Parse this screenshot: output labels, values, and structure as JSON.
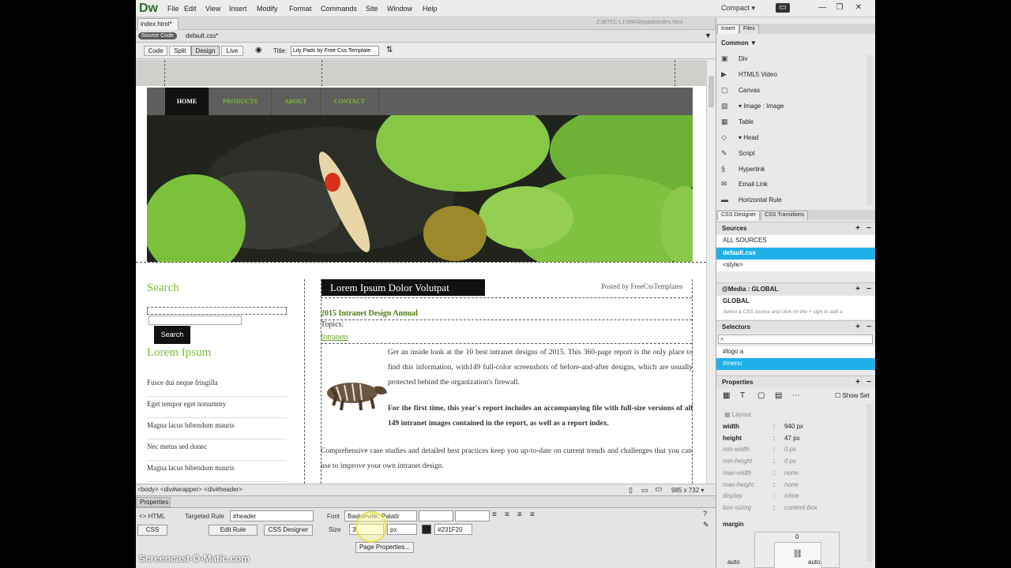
{
  "app": {
    "logo": "Dw",
    "menu": [
      "File",
      "Edit",
      "View",
      "Insert",
      "Modify",
      "Format",
      "Commands",
      "Site",
      "Window",
      "Help"
    ],
    "workspace": "Compact ▾",
    "window_controls": [
      "▭",
      "—",
      "❐",
      "✕"
    ]
  },
  "document": {
    "tab": "index.html*",
    "path": "Z:\\BTEC L1\\IM4\\lilypads\\index.html",
    "source_code": "Source Code",
    "related_file": "default.css*"
  },
  "toolbar": {
    "views": [
      "Code",
      "Split",
      "Design",
      "Live"
    ],
    "title_label": "Title:",
    "title_value": "Lily Pads by Free Css Template"
  },
  "page": {
    "nav": [
      "HOME",
      "PRODUCTS",
      "ABOUT",
      "CONTACT"
    ],
    "sidebar": {
      "search_title": "Search",
      "search_button": "Search",
      "lorem_title": "Lorem Ipsum",
      "links": [
        "Fusce dui neque fringilla",
        "Eget tempor eget nonummy",
        "Magna lacus bibendum mauris",
        "Nec metus sed donec",
        "Magna lacus bibendum mauris"
      ]
    },
    "main": {
      "heading": "Lorem Ipsum Dolor Volutpat",
      "posted_by": "Posted by FreeCssTemplates",
      "article_title": "2015 Intranet Design Annual",
      "topics": "Topics:",
      "topic_link": "Intranets",
      "para1": "Get an inside look at the 10 best intranet designs of 2015. This 360-page report is the only place to find this information, with149 full-color screenshots of before-and-after designs, which are usually protected behind the organization's firewall.",
      "para2": "For the first time, this year's report includes an accompanying file with full-size versions of all 149 intranet images contained in the report, as well as a report index.",
      "para3": "Comprehensive case studies and detailed best practices keep you up-to-date on current trends and challenges that you can use to improve your own intranet design."
    }
  },
  "statusbar": {
    "tags": "<body> <div#wrapper> <div#header>",
    "dimensions": "985 x 732 ▾"
  },
  "properties": {
    "tab": "Properties",
    "html_btn": "<> HTML",
    "css_btn": "CSS",
    "targeted_rule_label": "Targeted Rule",
    "targeted_rule": "#header",
    "edit_rule": "Edit Rule",
    "css_designer": "CSS Designer",
    "font_label": "Font",
    "font_value": "Baskerville, Palatir",
    "size_label": "Size",
    "size_value": "3",
    "size_unit": "px",
    "color_value": "#231F20",
    "page_properties": "Page Properties..."
  },
  "insert_panel": {
    "tabs": [
      "Insert",
      "Files"
    ],
    "category": "Common ▼",
    "items": [
      {
        "icon": "div-icon",
        "glyph": "▣",
        "label": "Div"
      },
      {
        "icon": "video-icon",
        "glyph": "▶",
        "label": "HTML5 Video"
      },
      {
        "icon": "canvas-icon",
        "glyph": "▢",
        "label": "Canvas"
      },
      {
        "icon": "image-icon",
        "glyph": "▨",
        "label": "▾ Image : Image"
      },
      {
        "icon": "table-icon",
        "glyph": "▦",
        "label": "Table"
      },
      {
        "icon": "head-icon",
        "glyph": "◇",
        "label": "▾ Head"
      },
      {
        "icon": "script-icon",
        "glyph": "✎",
        "label": "Script"
      },
      {
        "icon": "hyperlink-icon",
        "glyph": "§",
        "label": "Hyperlink"
      },
      {
        "icon": "email-icon",
        "glyph": "✉",
        "label": "Email Link"
      },
      {
        "icon": "rule-icon",
        "glyph": "▬",
        "label": "Horizontal Rule"
      }
    ]
  },
  "css_designer": {
    "tabs": [
      "CSS Designer",
      "CSS Transitions"
    ],
    "sources_label": "Sources",
    "sources": [
      "ALL SOURCES",
      "default.css",
      "<style>"
    ],
    "media_label": "@Media : GLOBAL",
    "media_global": "GLOBAL",
    "media_hint": "Select a CSS source and click on the + sign to add a",
    "selectors_label": "Selectors",
    "selectors": [
      "#logo a",
      "#menu"
    ],
    "properties_label": "Properties",
    "show_set": "Show Set",
    "layout_label": "Layout",
    "props": [
      {
        "name": "width",
        "value": "940 px",
        "set": true
      },
      {
        "name": "height",
        "value": "47 px",
        "set": true
      },
      {
        "name": "min-width",
        "value": "0 px",
        "set": false
      },
      {
        "name": "min-height",
        "value": "0 px",
        "set": false
      },
      {
        "name": "max-width",
        "value": "none",
        "set": false
      },
      {
        "name": "max-height",
        "value": "none",
        "set": false
      },
      {
        "name": "display",
        "value": "inline",
        "set": false
      },
      {
        "name": "box-sizing",
        "value": "content-box",
        "set": false
      }
    ],
    "margin_label": "margin",
    "margin_top": "0",
    "margin_left": "auto",
    "margin_right": "auto"
  },
  "watermark": "Screencast-O-Matic.com",
  "colors": {
    "accent": "#1fb0e8",
    "green": "#7dbc34",
    "dark": "#111111"
  }
}
